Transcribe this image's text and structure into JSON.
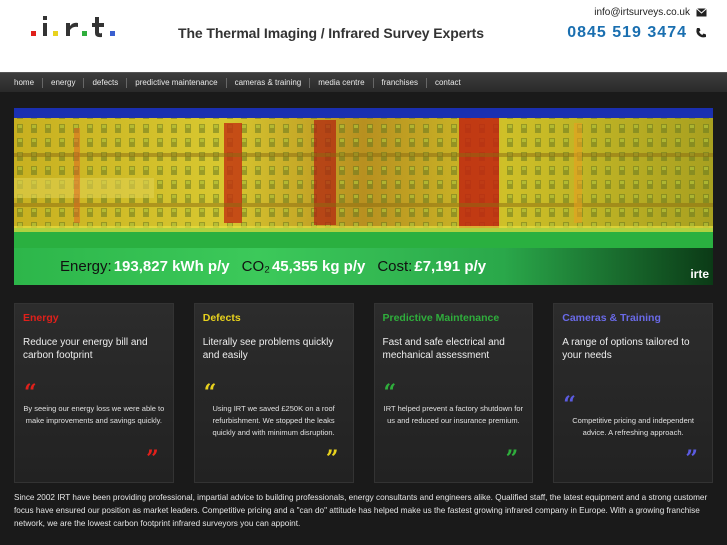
{
  "header": {
    "tagline": "The Thermal Imaging / Infrared Survey Experts",
    "email": "info@irtsurveys.co.uk",
    "phone": "0845 519 3474"
  },
  "nav": [
    "home",
    "energy",
    "defects",
    "predictive maintenance",
    "cameras & training",
    "media centre",
    "franchises",
    "contact"
  ],
  "hero": {
    "energy_label": "Energy:",
    "energy_value": "193,827 kWh p/y",
    "co2_label": "CO₂",
    "co2_value": "45,355 kg p/y",
    "cost_label": "Cost:",
    "cost_value": "£7,191 p/y",
    "brand": "irte"
  },
  "panels": [
    {
      "title": "Energy",
      "color": "#e0201b",
      "desc": "Reduce your energy bill and carbon footprint",
      "quote": "By seeing our energy loss we were able to make improvements and savings quickly."
    },
    {
      "title": "Defects",
      "color": "#e8d21e",
      "desc": "Literally see problems quickly and easily",
      "quote": "Using IRT we saved £250K on a roof refurbishment. We stopped the leaks quickly and with minimum disruption."
    },
    {
      "title": "Predictive Maintenance",
      "color": "#2fae3c",
      "desc": "Fast and safe electrical and mechanical assessment",
      "quote": "IRT helped prevent a factory shutdown for us and reduced our insurance premium."
    },
    {
      "title": "Cameras & Training",
      "color": "#5b5be0",
      "desc": "A range of options tailored to your needs",
      "quote": "Competitive pricing and independent advice. A refreshing approach."
    }
  ],
  "footer_text": "Since 2002 IRT have been providing professional, impartial advice to building professionals, energy consultants and engineers alike. Qualified staff, the latest equipment and a strong customer focus have ensured our position as market leaders. Competitive pricing and a \"can do\" attitude has helped make us the fastest growing infrared company in Europe. With a growing franchise network, we are the lowest carbon footprint infrared surveyors you can appoint.",
  "icons": {
    "email": "envelope-icon",
    "phone": "phone-icon"
  }
}
